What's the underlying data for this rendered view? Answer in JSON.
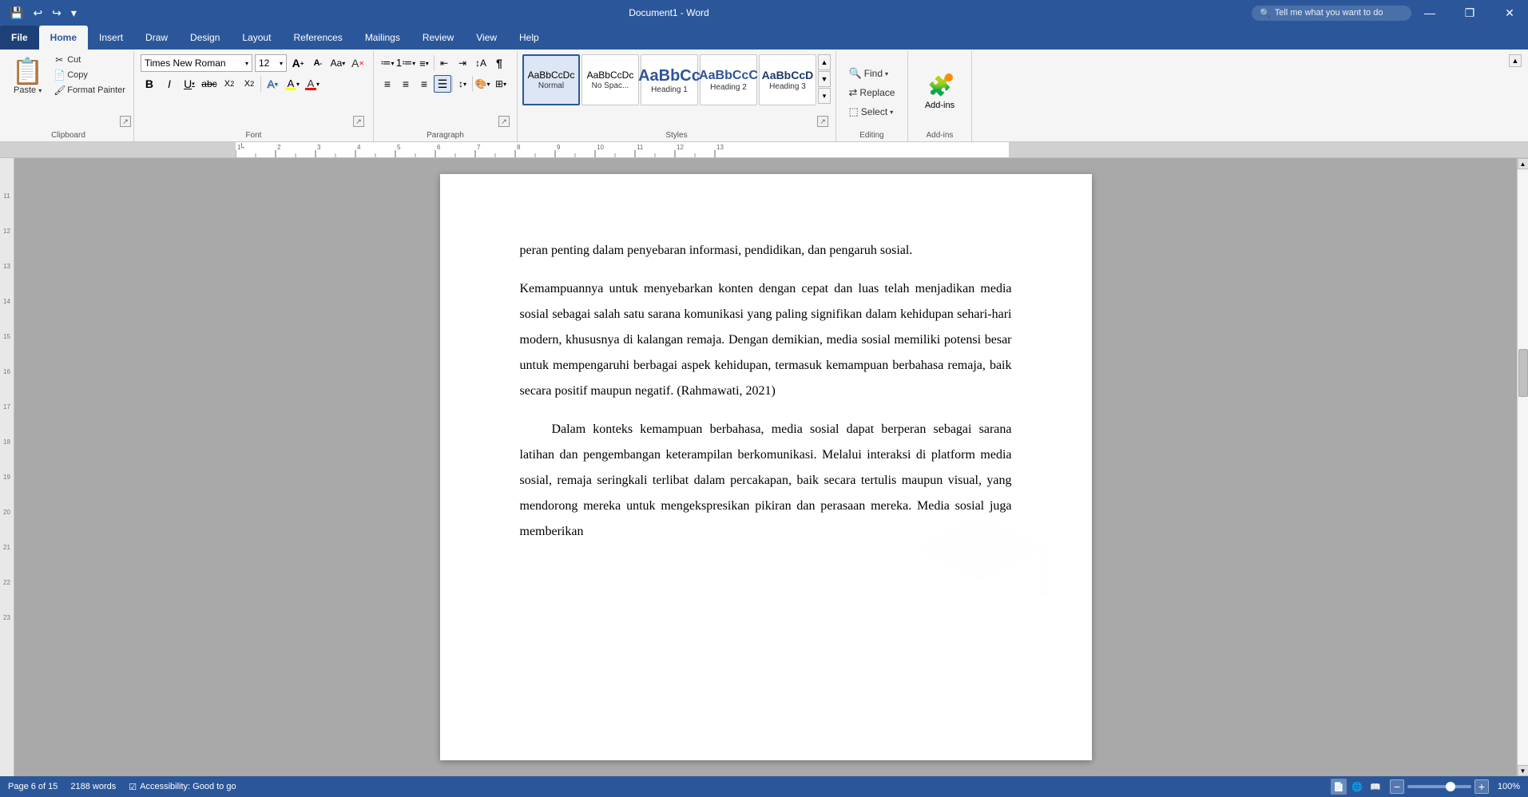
{
  "app": {
    "title": "Document1 - Word",
    "file_name": "Document1 - Word"
  },
  "tabs": {
    "items": [
      "File",
      "Home",
      "Insert",
      "Draw",
      "Design",
      "Layout",
      "References",
      "Mailings",
      "Review",
      "View",
      "Help"
    ],
    "active": "Home"
  },
  "quick_access": {
    "save_label": "💾",
    "undo_label": "↩",
    "redo_label": "↪"
  },
  "tell_me": {
    "placeholder": "Tell me what you want to do"
  },
  "clipboard": {
    "group_label": "Clipboard",
    "paste_label": "Paste",
    "cut_label": "Cut",
    "copy_label": "Copy",
    "format_painter_label": "Format Painter"
  },
  "font": {
    "group_label": "Font",
    "font_name": "Times New Roman",
    "font_size": "12",
    "grow_label": "A",
    "shrink_label": "A",
    "change_case_label": "Aa",
    "clear_formatting_label": "A",
    "bold_label": "B",
    "italic_label": "I",
    "underline_label": "U",
    "strikethrough_label": "abc",
    "subscript_label": "X₂",
    "superscript_label": "X²",
    "font_color_label": "A",
    "highlight_label": "A",
    "text_effect_label": "A"
  },
  "paragraph": {
    "group_label": "Paragraph",
    "bullets_label": "≡",
    "numbering_label": "≡",
    "multilevel_label": "≡",
    "decrease_indent_label": "⇤",
    "increase_indent_label": "⇥",
    "sort_label": "↕",
    "show_para_label": "¶",
    "align_left_label": "≡",
    "align_center_label": "≡",
    "align_right_label": "≡",
    "justify_label": "≡",
    "line_spacing_label": "↕",
    "shading_label": "🖌",
    "borders_label": "⊞"
  },
  "styles": {
    "group_label": "Styles",
    "items": [
      {
        "id": "normal",
        "preview": "¶",
        "label": "Normal",
        "active": true
      },
      {
        "id": "no-spacing",
        "preview": "¶",
        "label": "No Spac...",
        "active": false
      },
      {
        "id": "heading1",
        "preview": "H1",
        "label": "Heading 1",
        "active": false
      },
      {
        "id": "heading2",
        "preview": "H2",
        "label": "Heading 2",
        "active": false
      },
      {
        "id": "heading3",
        "preview": "H3",
        "label": "Heading 3",
        "active": false
      }
    ]
  },
  "editing": {
    "group_label": "Editing",
    "find_label": "Find",
    "replace_label": "Replace",
    "select_label": "Select"
  },
  "addins": {
    "group_label": "Add-ins",
    "button_label": "Add-ins",
    "dot_color": "#ff8c00"
  },
  "document": {
    "paragraphs": [
      {
        "id": "p1",
        "text": "peran penting dalam penyebaran informasi, pendidikan, dan pengaruh sosial.",
        "indent": false
      },
      {
        "id": "p2",
        "text": "Kemampuannya untuk menyebarkan konten dengan cepat dan luas telah menjadikan media sosial sebagai salah satu sarana komunikasi yang paling signifikan dalam kehidupan sehari-hari modern, khususnya di kalangan remaja. Dengan demikian, media sosial memiliki potensi besar untuk mempengaruhi berbagai aspek kehidupan, termasuk kemampuan berbahasa remaja, baik secara positif maupun negatif. (Rahmawati, 2021)",
        "indent": false
      },
      {
        "id": "p3",
        "text": "Dalam konteks kemampuan berbahasa, media sosial dapat berperan sebagai sarana latihan dan pengembangan keterampilan berkomunikasi. Melalui interaksi di platform media sosial, remaja seringkali terlibat dalam percakapan, baik secara tertulis maupun visual, yang mendorong mereka untuk mengekspresikan pikiran dan perasaan mereka. Media sosial juga memberikan",
        "indent": true
      }
    ]
  },
  "status": {
    "page_info": "Page 6 of 15",
    "word_count": "2188 words",
    "accessibility": "Accessibility: Good to go",
    "view_icons": [
      "📄",
      "📋",
      "🖨"
    ],
    "zoom_level": "100%"
  },
  "ruler": {
    "numbers": [
      "11",
      "12",
      "13",
      "14",
      "15",
      "16",
      "17",
      "18",
      "19",
      "20",
      "21",
      "22",
      "23"
    ]
  }
}
